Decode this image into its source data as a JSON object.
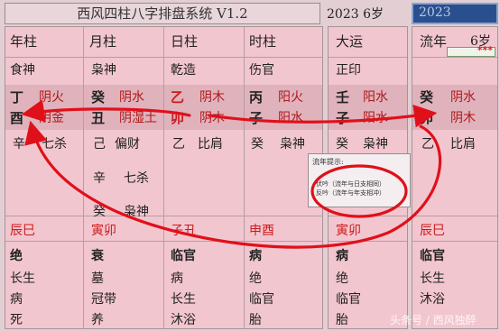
{
  "app": {
    "title": "西风四柱八字排盘系统 V1.2"
  },
  "top": {
    "year_info": "2023 6岁",
    "year_select": "2023"
  },
  "pillars": [
    {
      "header": "年柱",
      "shishen": "食神",
      "stem": "丁",
      "stem_el": "阴火",
      "branch": "酉",
      "branch_el": "阴金",
      "hidden": [
        [
          "辛",
          "七杀"
        ]
      ],
      "kongwang": "辰巳",
      "state": "绝",
      "life": [
        "长生",
        "病",
        "死"
      ]
    },
    {
      "header": "月柱",
      "shishen": "枭神",
      "stem": "癸",
      "stem_el": "阴水",
      "branch": "丑",
      "branch_el": "阴湿土",
      "hidden": [
        [
          "己",
          "偏财"
        ],
        [
          "辛",
          "七杀"
        ],
        [
          "癸",
          "枭神"
        ]
      ],
      "kongwang": "寅卯",
      "state": "衰",
      "life": [
        "墓",
        "冠带",
        "养"
      ]
    },
    {
      "header": "日柱",
      "shishen": "乾造",
      "stem": "乙",
      "stem_el": "阴木",
      "branch": "卯",
      "branch_el": "阴木",
      "hidden": [
        [
          "乙",
          "比肩"
        ]
      ],
      "kongwang": "子丑",
      "state": "临官",
      "life": [
        "病",
        "长生",
        "沐浴"
      ]
    },
    {
      "header": "时柱",
      "shishen": "伤官",
      "stem": "丙",
      "stem_el": "阳火",
      "branch": "子",
      "branch_el": "阳水",
      "hidden": [
        [
          "癸",
          "枭神"
        ]
      ],
      "kongwang": "申酉",
      "state": "病",
      "life": [
        "绝",
        "临官",
        "胎"
      ]
    }
  ],
  "dayun": {
    "header": "大运",
    "shishen": "正印",
    "stem": "壬",
    "stem_el": "阳水",
    "branch": "子",
    "branch_el": "阳水",
    "hidden": [
      [
        "癸",
        "枭神"
      ]
    ],
    "kongwang": "寅卯",
    "state": "病",
    "life": [
      "绝",
      "临官",
      "胎"
    ]
  },
  "liunian": {
    "header": "流年",
    "age": "6岁",
    "stars": "***",
    "stem": "癸",
    "stem_el": "阴水",
    "branch": "卯",
    "branch_el": "阴木",
    "hidden": [
      [
        "乙",
        "比肩"
      ]
    ],
    "kongwang": "辰巳",
    "state": "临官",
    "life": [
      "长生",
      "沐浴"
    ]
  },
  "popup": {
    "title": "流年提示:",
    "line1": "伏吟（流年与日支相同）",
    "line2": "反吟（流年与年支相冲）"
  },
  "watermark": "头条号 / 西风独醉",
  "colors": {
    "panel": "#f2c6cf",
    "band": "#dfb2bc",
    "element": "#b01818",
    "annotation": "#e0101a",
    "select": "#2a4f8f"
  }
}
